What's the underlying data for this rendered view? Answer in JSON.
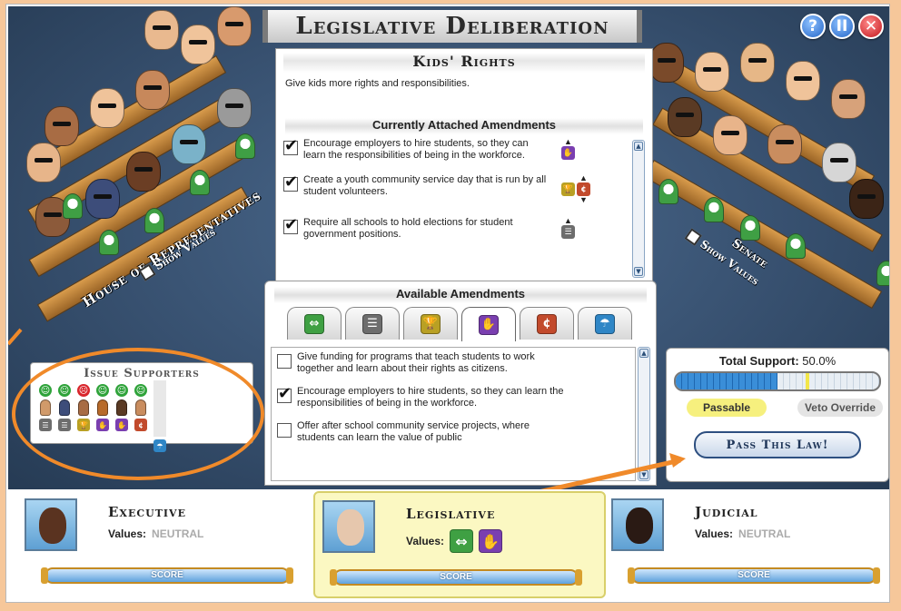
{
  "title": "Legislative Deliberation",
  "controls": {
    "help": "?",
    "pause": "II",
    "close": "✕"
  },
  "house": {
    "label": "House of Representatives",
    "show_values": "Show Values"
  },
  "senate": {
    "label": "Senate",
    "show_values": "Show Values"
  },
  "bill": {
    "name": "Kids' Rights",
    "description": "Give kids more rights and responsibilities.",
    "attached_heading": "Currently Attached Amendments",
    "attached": [
      {
        "text": "Encourage employers to hire students, so they can learn the responsibilities of being in the workforce.",
        "checked": true
      },
      {
        "text": "Create a youth community service day that is run by all student volunteers.",
        "checked": true
      },
      {
        "text": "Require all schools to hold elections for student government positions.",
        "checked": true
      }
    ]
  },
  "available": {
    "heading": "Available Amendments",
    "tabs": [
      {
        "icon": "equality-icon",
        "symbol": "⇔",
        "color": "#3fa043"
      },
      {
        "icon": "government-icon",
        "symbol": "☰",
        "color": "#6d6d6d"
      },
      {
        "icon": "trophy-icon",
        "symbol": "🏆",
        "color": "#b9a024"
      },
      {
        "icon": "handshake-icon",
        "symbol": "✋",
        "color": "#7a3fb0"
      },
      {
        "icon": "money-icon",
        "symbol": "¢",
        "color": "#c24a2c"
      },
      {
        "icon": "umbrella-icon",
        "symbol": "☂",
        "color": "#2f86c6"
      }
    ],
    "active_tab": 3,
    "items": [
      {
        "text": "Give funding for programs that teach students to work together and learn about their rights as citizens.",
        "checked": false
      },
      {
        "text": "Encourage employers to hire students, so they can learn the responsibilities of being in the workforce.",
        "checked": true
      },
      {
        "text": "Offer after school community service projects, where students can learn the value of public",
        "checked": false
      }
    ]
  },
  "issue_supporters": {
    "title": "Issue Supporters",
    "columns": [
      {
        "mood": "happy",
        "icon": "government-icon",
        "icon_color": "#6d6d6d"
      },
      {
        "mood": "happy",
        "icon": "government-icon",
        "icon_color": "#6d6d6d"
      },
      {
        "mood": "sad",
        "icon": "trophy-icon",
        "icon_color": "#b9a024"
      },
      {
        "mood": "happy",
        "icon": "handshake-icon",
        "icon_color": "#7a3fb0"
      },
      {
        "mood": "happy",
        "icon": "handshake-icon",
        "icon_color": "#7a3fb0"
      },
      {
        "mood": "happy",
        "icon": "money-icon",
        "icon_color": "#c24a2c"
      },
      {
        "mood": "none",
        "icon": "umbrella-icon",
        "icon_color": "#2f86c6"
      }
    ]
  },
  "support": {
    "label": "Total Support:",
    "value": "50.0%",
    "fraction": 0.5,
    "passable_threshold": 0.5,
    "veto_threshold": 0.64,
    "passable": "Passable",
    "veto_override": "Veto Override",
    "pass_button": "Pass This Law!"
  },
  "branches": {
    "executive": {
      "name": "Executive",
      "values_label": "Values:",
      "values": "NEUTRAL",
      "score": "SCORE"
    },
    "legislative": {
      "name": "Legislative",
      "values_label": "Values:",
      "value_icons": [
        "equality-icon",
        "handshake-icon"
      ],
      "score": "SCORE"
    },
    "judicial": {
      "name": "Judicial",
      "values_label": "Values:",
      "values": "NEUTRAL",
      "score": "SCORE"
    }
  },
  "colors": {
    "accent_orange": "#f08a2a",
    "stage": "#37506f"
  }
}
